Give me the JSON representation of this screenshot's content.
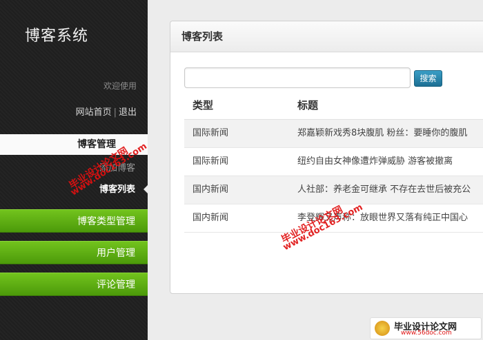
{
  "sidebar": {
    "app_title": "博客系统",
    "welcome": "欢迎使用",
    "home_link": "网站首页",
    "separator": "|",
    "logout_link": "退出",
    "group_header": "博客管理",
    "sub_add": "添加博客",
    "sub_list": "博客列表",
    "green_buttons": [
      "博客类型管理",
      "用户管理",
      "评论管理"
    ]
  },
  "main": {
    "panel_title": "博客列表",
    "search": {
      "value": "",
      "placeholder": "",
      "button_label": "搜索"
    },
    "table": {
      "headers": [
        "类型",
        "标题"
      ],
      "rows": [
        [
          "国际新闻",
          "郑嘉颖新戏秀8块腹肌 粉丝：要睡你的腹肌"
        ],
        [
          "国际新闻",
          "纽约自由女神像遭炸弹威胁 游客被撤离"
        ],
        [
          "国内新闻",
          "人社部：养老金可继承 不存在去世后被充公"
        ],
        [
          "国内新闻",
          "李登辉又声称：放眼世界又落有纯正中国心"
        ]
      ]
    }
  },
  "overlays": {
    "watermark_cn": "毕业设计论文网",
    "watermark_url": "www.doc163.com",
    "logo_text": "毕业设计论文网",
    "logo_url": "www.56doc.com"
  }
}
